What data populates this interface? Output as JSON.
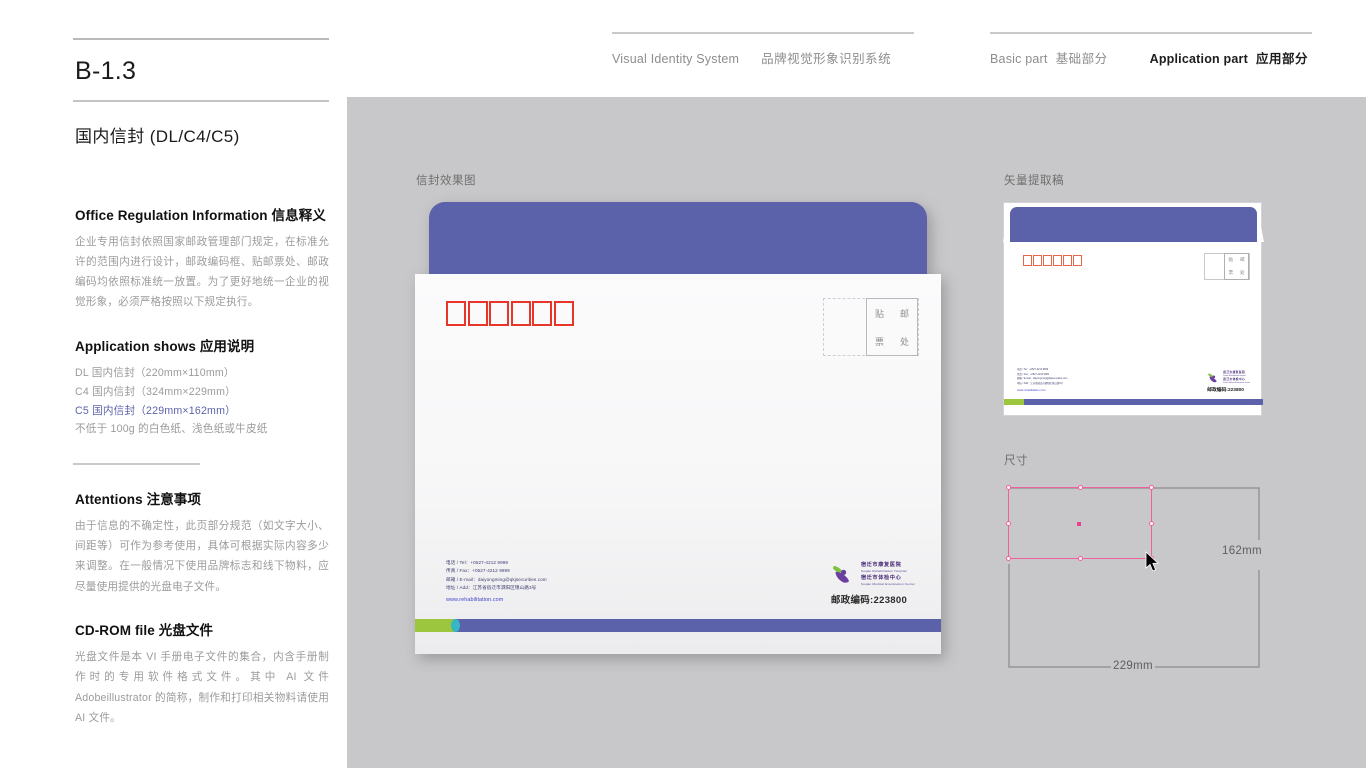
{
  "header": {
    "left_group": {
      "en": "Visual Identity System",
      "cn": "品牌视觉形象识别系统"
    },
    "right_group": {
      "basic_en": "Basic part",
      "basic_cn": "基础部分",
      "application_en": "Application part",
      "application_cn": "应用部分"
    }
  },
  "sidebar": {
    "code": "B-1.3",
    "title": "国内信封 (DL/C4/C5)",
    "sections": [
      {
        "heading_en": "Office Regulation Information",
        "heading_cn": "信息释义",
        "body": "企业专用信封依照国家邮政管理部门规定，在标准允许的范围内进行设计，邮政编码框、贴邮票处、邮政编码均依照标准统一放置。为了更好地统一企业的视觉形象，必须严格按照以下规定执行。"
      },
      {
        "heading_en": "Application shows",
        "heading_cn": "应用说明",
        "specs": [
          {
            "text": "DL 国内信封（220mm×110mm）",
            "highlight": false
          },
          {
            "text": "C4 国内信封（324mm×229mm）",
            "highlight": false
          },
          {
            "text": "C5 国内信封（229mm×162mm）",
            "highlight": true
          },
          {
            "text": "不低于 100g 的白色纸、浅色纸或牛皮纸",
            "highlight": false
          }
        ]
      },
      {
        "heading_en": "Attentions",
        "heading_cn": "注意事项",
        "body": "由于信息的不确定性，此页部分规范（如文字大小、间距等）可作为参考使用，具体可根据实际内容多少来调整。在一般情况下使用品牌标志和线下物料，应尽量使用提供的光盘电子文件。"
      },
      {
        "heading_en": "CD-ROM file",
        "heading_cn": "光盘文件",
        "body": "光盘文件是本 VI 手册电子文件的集合，内含手册制作时的专用软件格式文件。其中 AI 文件 Adobeillustrator 的简称，制作和打印相关物料请使用 AI 文件。"
      }
    ]
  },
  "canvas": {
    "mockup_label": "信封效果图",
    "vector_label": "矢量提取稿",
    "dimension_label": "尺寸"
  },
  "envelope": {
    "postcode_box_count": 6,
    "stamp_note": [
      "贴",
      "邮",
      "票",
      "处"
    ],
    "contact": [
      "电话 / Tel：+0527-4212 9999",
      "传真 / Fax：+0527-4212 9999",
      "邮箱 / E-mail：daiyongming@qkjsecurities.com",
      "地址 / Add：江苏省宿迁市泗阳区锦山路3号"
    ],
    "website": "www.rehabilitation.com",
    "brand": {
      "cn_line1": "宿迁市康复医院",
      "en_line1": "Suqian Rehabilitation Hospital",
      "cn_line2": "宿迁市体检中心",
      "en_line2": "Suqian Medical Examination Center"
    },
    "postal_code_label": "邮政编码:223800"
  },
  "dimensions": {
    "width_label": "229mm",
    "height_label": "162mm"
  },
  "colors": {
    "brand_purple": "#5c62aa",
    "brand_green": "#9cc63d",
    "brand_teal": "#35b8c4",
    "postcode_red": "#e8352a",
    "selection_pink": "#f0619b",
    "canvas_gray": "#c8c8ca"
  }
}
